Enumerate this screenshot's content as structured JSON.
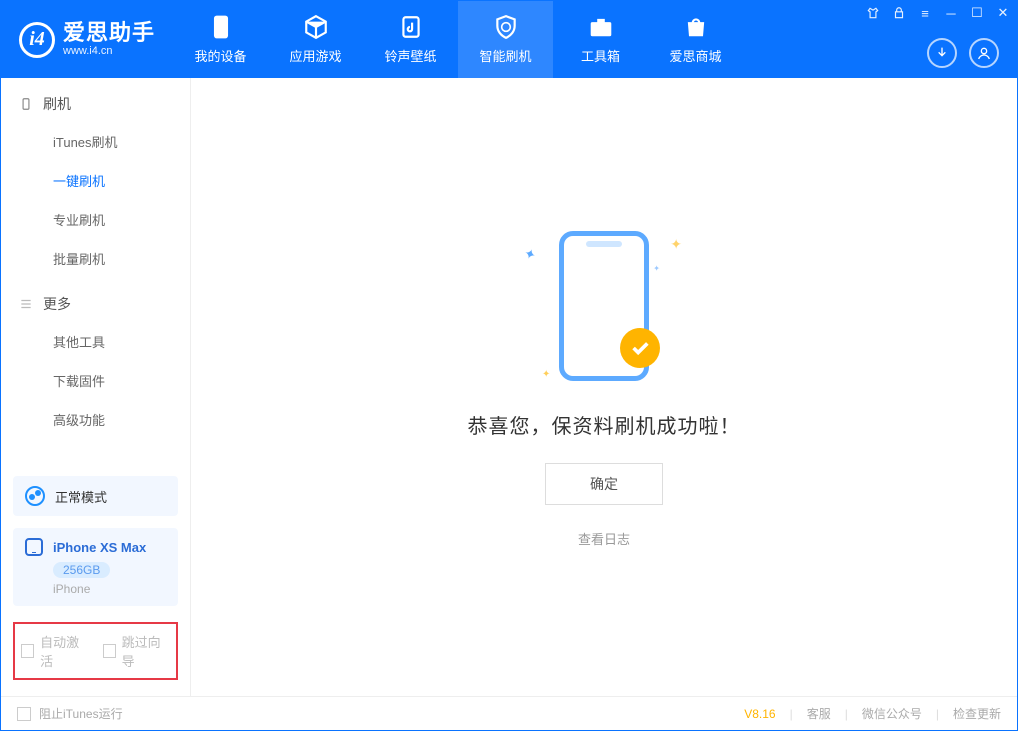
{
  "app": {
    "name": "爱思助手",
    "url": "www.i4.cn"
  },
  "nav": {
    "tabs": [
      {
        "label": "我的设备"
      },
      {
        "label": "应用游戏"
      },
      {
        "label": "铃声壁纸"
      },
      {
        "label": "智能刷机"
      },
      {
        "label": "工具箱"
      },
      {
        "label": "爱思商城"
      }
    ],
    "active_index": 3
  },
  "sidebar": {
    "sections": [
      {
        "title": "刷机",
        "items": [
          {
            "label": "iTunes刷机"
          },
          {
            "label": "一键刷机"
          },
          {
            "label": "专业刷机"
          },
          {
            "label": "批量刷机"
          }
        ],
        "active_index": 1
      },
      {
        "title": "更多",
        "items": [
          {
            "label": "其他工具"
          },
          {
            "label": "下载固件"
          },
          {
            "label": "高级功能"
          }
        ]
      }
    ],
    "mode_label": "正常模式",
    "device": {
      "name": "iPhone XS Max",
      "capacity": "256GB",
      "type": "iPhone"
    },
    "checkboxes": {
      "auto_activate": "自动激活",
      "skip_guide": "跳过向导"
    }
  },
  "main": {
    "success_message": "恭喜您，保资料刷机成功啦！",
    "ok_button": "确定",
    "view_log": "查看日志"
  },
  "statusbar": {
    "block_itunes": "阻止iTunes运行",
    "version": "V8.16",
    "links": {
      "support": "客服",
      "wechat": "微信公众号",
      "check_update": "检查更新"
    }
  }
}
